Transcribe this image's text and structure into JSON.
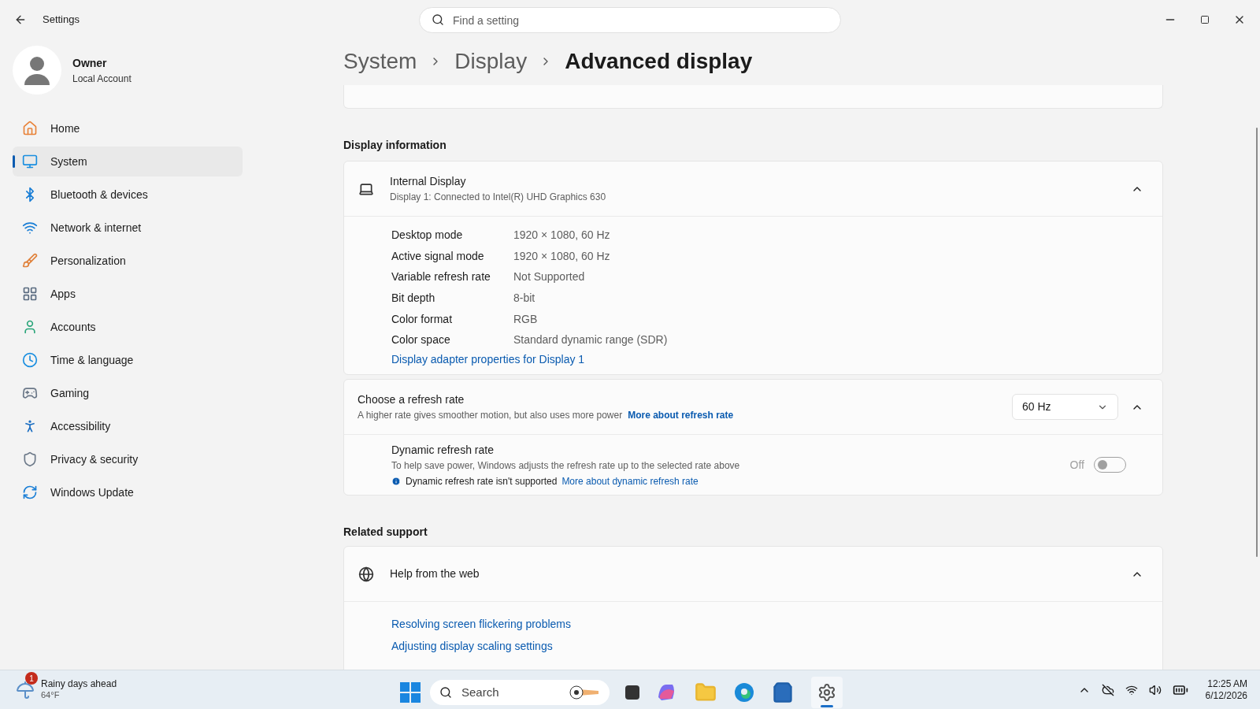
{
  "window": {
    "title": "Settings"
  },
  "search": {
    "placeholder": "Find a setting"
  },
  "user": {
    "name": "Owner",
    "account": "Local Account"
  },
  "nav": [
    {
      "label": "Home",
      "selected": false
    },
    {
      "label": "System",
      "selected": true
    },
    {
      "label": "Bluetooth & devices",
      "selected": false
    },
    {
      "label": "Network & internet",
      "selected": false
    },
    {
      "label": "Personalization",
      "selected": false
    },
    {
      "label": "Apps",
      "selected": false
    },
    {
      "label": "Accounts",
      "selected": false
    },
    {
      "label": "Time & language",
      "selected": false
    },
    {
      "label": "Gaming",
      "selected": false
    },
    {
      "label": "Accessibility",
      "selected": false
    },
    {
      "label": "Privacy & security",
      "selected": false
    },
    {
      "label": "Windows Update",
      "selected": false
    }
  ],
  "breadcrumb": [
    "System",
    "Display",
    "Advanced display"
  ],
  "display_information": {
    "heading": "Display information",
    "title": "Internal Display",
    "subtitle": "Display 1: Connected to Intel(R) UHD Graphics 630",
    "expanded": true,
    "rows": [
      {
        "label": "Desktop mode",
        "value": "1920 × 1080, 60 Hz"
      },
      {
        "label": "Active signal mode",
        "value": "1920 × 1080, 60 Hz"
      },
      {
        "label": "Variable refresh rate",
        "value": "Not Supported"
      },
      {
        "label": "Bit depth",
        "value": "8-bit"
      },
      {
        "label": "Color format",
        "value": "RGB"
      },
      {
        "label": "Color space",
        "value": "Standard dynamic range (SDR)"
      }
    ],
    "link": "Display adapter properties for Display 1"
  },
  "refresh_rate": {
    "title": "Choose a refresh rate",
    "description": "A higher rate gives smoother motion, but also uses more power",
    "link": "More about refresh rate",
    "value": "60 Hz",
    "expanded": true,
    "dynamic": {
      "title": "Dynamic refresh rate",
      "description": "To help save power, Windows adjusts the refresh rate up to the selected rate above",
      "note": "Dynamic refresh rate isn't supported",
      "link": "More about dynamic refresh rate",
      "state_label": "Off",
      "on": false,
      "disabled": true
    }
  },
  "related_support": {
    "heading": "Related support",
    "title": "Help from the web",
    "expanded": true,
    "links": [
      "Resolving screen flickering problems",
      "Adjusting display scaling settings"
    ]
  },
  "taskbar": {
    "weather": {
      "title": "Rainy days ahead",
      "temp": "64°F",
      "badge": "1"
    },
    "search": "Search",
    "time": "12:25 AM",
    "date": "6/12/2026"
  }
}
